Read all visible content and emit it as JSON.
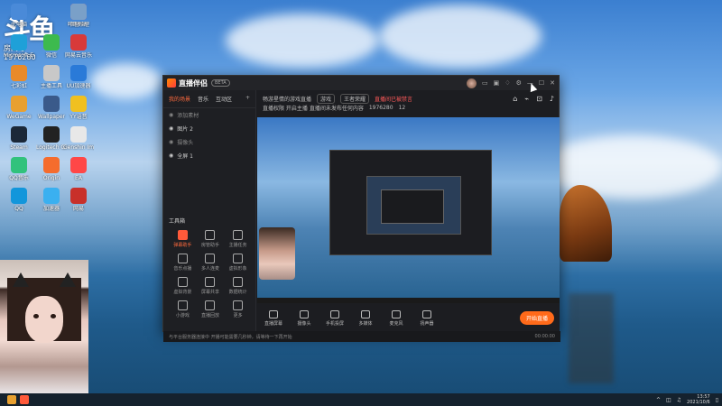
{
  "watermark": {
    "logo": "斗鱼",
    "room_label": "房间号",
    "room_number": "1976280"
  },
  "desktop_icons": [
    {
      "label": "此电脑",
      "color": "#4a8ad8"
    },
    {
      "label": "哔哩哔哩",
      "color": "#f05a70"
    },
    {
      "label": "回收站",
      "color": "#7aa0c8"
    },
    {
      "label": "Microsoft Edge",
      "color": "#1fa0d8"
    },
    {
      "label": "微信",
      "color": "#3dba4e"
    },
    {
      "label": "网易云音乐",
      "color": "#d83a3a"
    },
    {
      "label": "七彩虹",
      "color": "#e88a2a"
    },
    {
      "label": "主播工具",
      "color": "#c8c8c8"
    },
    {
      "label": "UU加速器",
      "color": "#2a7ad8"
    },
    {
      "label": "WeGame",
      "color": "#e8a030"
    },
    {
      "label": "Wallpaper",
      "color": "#3a5a8a"
    },
    {
      "label": "YY语音",
      "color": "#f0c020"
    },
    {
      "label": "Steam",
      "color": "#1b2838"
    },
    {
      "label": "Logitech G HUB",
      "color": "#222222"
    },
    {
      "label": "Genshin Impact",
      "color": "#e8e8e8"
    },
    {
      "label": "QQ音乐",
      "color": "#31c27c"
    },
    {
      "label": "Origin",
      "color": "#f56c2d"
    },
    {
      "label": "EA",
      "color": "#ff4747"
    },
    {
      "label": "QQ",
      "color": "#1296db"
    },
    {
      "label": "加速器",
      "color": "#3ab0f0"
    },
    {
      "label": "网易",
      "color": "#c8302a"
    }
  ],
  "app": {
    "name": "直播伴侣",
    "version": "BETA",
    "title_icons": [
      "message-icon",
      "screen-icon",
      "shirt-icon",
      "settings-icon",
      "minimize-icon",
      "maximize-icon",
      "close-icon"
    ],
    "tabs": [
      "我的场景",
      "音乐",
      "互动区"
    ],
    "scenes": [
      {
        "label": "添加素材",
        "on": false
      },
      {
        "label": "图片 2",
        "on": true
      },
      {
        "label": "摄像头",
        "on": false
      },
      {
        "label": "全屏 1",
        "on": true
      }
    ],
    "tools_label": "工具箱",
    "tools": [
      "弹幕助手",
      "房管助手",
      "主播任务",
      "音乐点播",
      "多人连麦",
      "虚拟形象",
      "虚拟背景",
      "屏幕共享",
      "数据统计",
      "小游戏",
      "直播回放",
      "更多"
    ],
    "info": {
      "room_title": "畅游星情的游戏直播",
      "tag": "游戏",
      "category": "王者荣耀",
      "warning": "直播间已被禁言",
      "line2": "直播权限  开启主播  直播间未发布任何内容",
      "room_id": "1976280",
      "viewers": "12"
    },
    "bottom_tools": [
      "直播屏幕",
      "摄像头",
      "手机投屏",
      "多媒体",
      "麦克风",
      "扬声器"
    ],
    "start_label": "开始直播",
    "status_text": "与平台服务器连接中  开播可能需要几秒钟，请等待一下再开始",
    "status_time": "00:00:00"
  },
  "taskbar": {
    "time": "13:57",
    "date": "2021/10/6"
  }
}
